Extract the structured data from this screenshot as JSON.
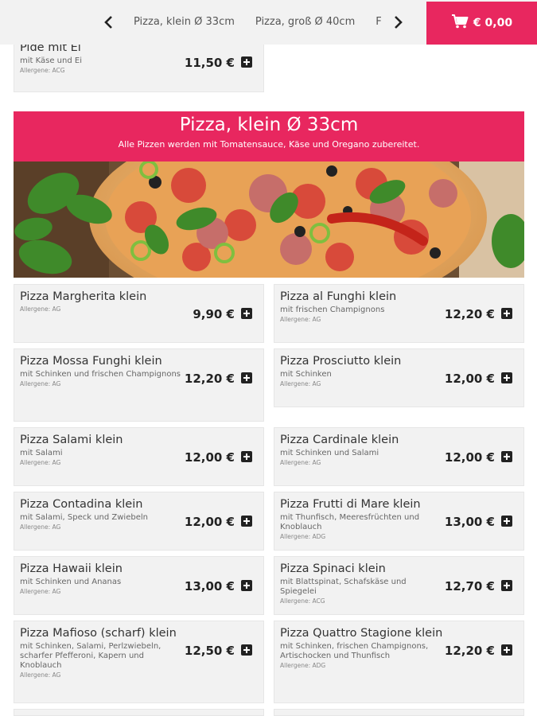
{
  "nav": {
    "categories": [
      "Pizza, klein Ø 33cm",
      "Pizza, groß Ø 40cm",
      "F"
    ],
    "cart_total": "€ 0,00"
  },
  "prev_item": {
    "name": "Pide mit Ei",
    "desc": "mit Käse und Ei",
    "allergens": "Allergene: ACG",
    "price": "11,50 €"
  },
  "category": {
    "title": "Pizza, klein Ø 33cm",
    "subtitle": "Alle Pizzen werden mit Tomatensauce, Käse und Oregano zubereitet."
  },
  "items": [
    {
      "name": "Pizza Margherita klein",
      "desc": "",
      "allergens": "Allergene: AG",
      "price": "9,90 €"
    },
    {
      "name": "Pizza al Funghi klein",
      "desc": "mit frischen Champignons",
      "allergens": "Allergene: AG",
      "price": "12,20 €"
    },
    {
      "name": "Pizza Mossa Funghi klein",
      "desc": "mit Schinken und frischen Champignons",
      "allergens": "Allergene: AG",
      "price": "12,20 €"
    },
    {
      "name": "Pizza Prosciutto klein",
      "desc": "mit Schinken",
      "allergens": "Allergene: AG",
      "price": "12,00 €"
    },
    {
      "name": "Pizza Salami klein",
      "desc": "mit Salami",
      "allergens": "Allergene: AG",
      "price": "12,00 €"
    },
    {
      "name": "Pizza Cardinale klein",
      "desc": "mit Schinken und Salami",
      "allergens": "Allergene: AG",
      "price": "12,00 €"
    },
    {
      "name": "Pizza Contadina klein",
      "desc": "mit Salami, Speck und Zwiebeln",
      "allergens": "Allergene: AG",
      "price": "12,00 €"
    },
    {
      "name": "Pizza Frutti di Mare klein",
      "desc": "mit Thunfisch, Meeresfrüchten und Knoblauch",
      "allergens": "Allergene: ADG",
      "price": "13,00 €"
    },
    {
      "name": "Pizza Hawaii klein",
      "desc": "mit Schinken und Ananas",
      "allergens": "Allergene: AG",
      "price": "13,00 €"
    },
    {
      "name": "Pizza Spinaci klein",
      "desc": "mit Blattspinat, Schafskäse und Spiegelei",
      "allergens": "Allergene: ACG",
      "price": "12,70 €"
    },
    {
      "name": "Pizza Mafioso (scharf) klein",
      "desc": "mit Schinken, Salami, Perlzwiebeln, scharfer Pfefferoni, Kapern und Knoblauch",
      "allergens": "Allergene: AG",
      "price": "12,50 €"
    },
    {
      "name": "Pizza Quattro Stagione klein",
      "desc": "mit Schinken, frischen Champignons, Artischocken und Thunfisch",
      "allergens": "Allergene: ADG",
      "price": "12,20 €"
    }
  ],
  "colors": {
    "accent": "#e8275f",
    "card_bg": "#f2f2f2"
  },
  "icons": {
    "prev": "chevron-left-icon",
    "next": "chevron-right-icon",
    "cart": "shopping-cart-icon",
    "add": "plus-square-icon"
  }
}
